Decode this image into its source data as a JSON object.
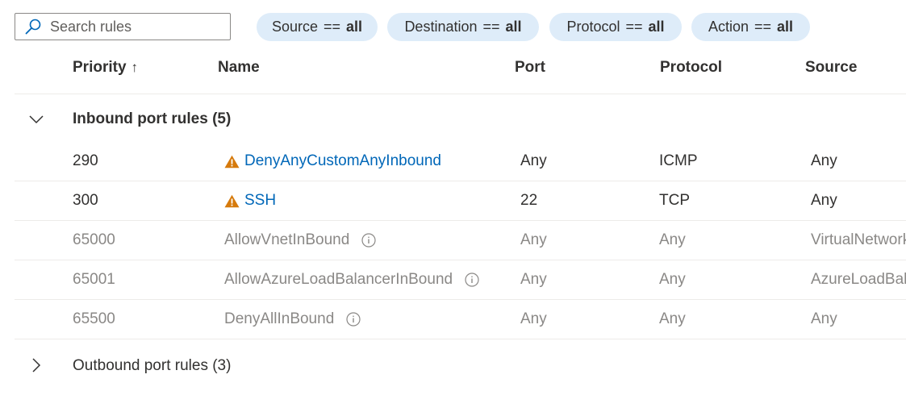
{
  "search": {
    "placeholder": "Search rules",
    "value": ""
  },
  "filters": [
    {
      "key": "Source",
      "operator": "==",
      "value": "all"
    },
    {
      "key": "Destination",
      "operator": "==",
      "value": "all"
    },
    {
      "key": "Protocol",
      "operator": "==",
      "value": "all"
    },
    {
      "key": "Action",
      "operator": "==",
      "value": "all"
    }
  ],
  "columns": {
    "priority": "Priority",
    "priority_sort": "↑",
    "name": "Name",
    "port": "Port",
    "protocol": "Protocol",
    "source": "Source"
  },
  "groups": {
    "inbound": {
      "label": "Inbound port rules (5)",
      "expanded": true,
      "rows": [
        {
          "priority": "290",
          "name": "DenyAnyCustomAnyInbound",
          "port": "Any",
          "protocol": "ICMP",
          "source": "Any"
        },
        {
          "priority": "300",
          "name": "SSH",
          "port": "22",
          "protocol": "TCP",
          "source": "Any"
        },
        {
          "priority": "65000",
          "name": "AllowVnetInBound",
          "port": "Any",
          "protocol": "Any",
          "source": "VirtualNetwork"
        },
        {
          "priority": "65001",
          "name": "AllowAzureLoadBalancerInBound",
          "port": "Any",
          "protocol": "Any",
          "source": "AzureLoadBalancer"
        },
        {
          "priority": "65500",
          "name": "DenyAllInBound",
          "port": "Any",
          "protocol": "Any",
          "source": "Any"
        }
      ]
    },
    "outbound": {
      "label": "Outbound port rules (3)",
      "expanded": false
    }
  },
  "colors": {
    "link": "#0067b8",
    "warning": "#d67a0c",
    "pill_bg": "#deecf9",
    "muted_text": "#8a8886",
    "text": "#323130"
  },
  "icons": {
    "search": "search-icon",
    "warning": "warning-icon",
    "info": "info-icon",
    "expand": "chevron-down-icon",
    "collapse": "chevron-right-icon"
  }
}
